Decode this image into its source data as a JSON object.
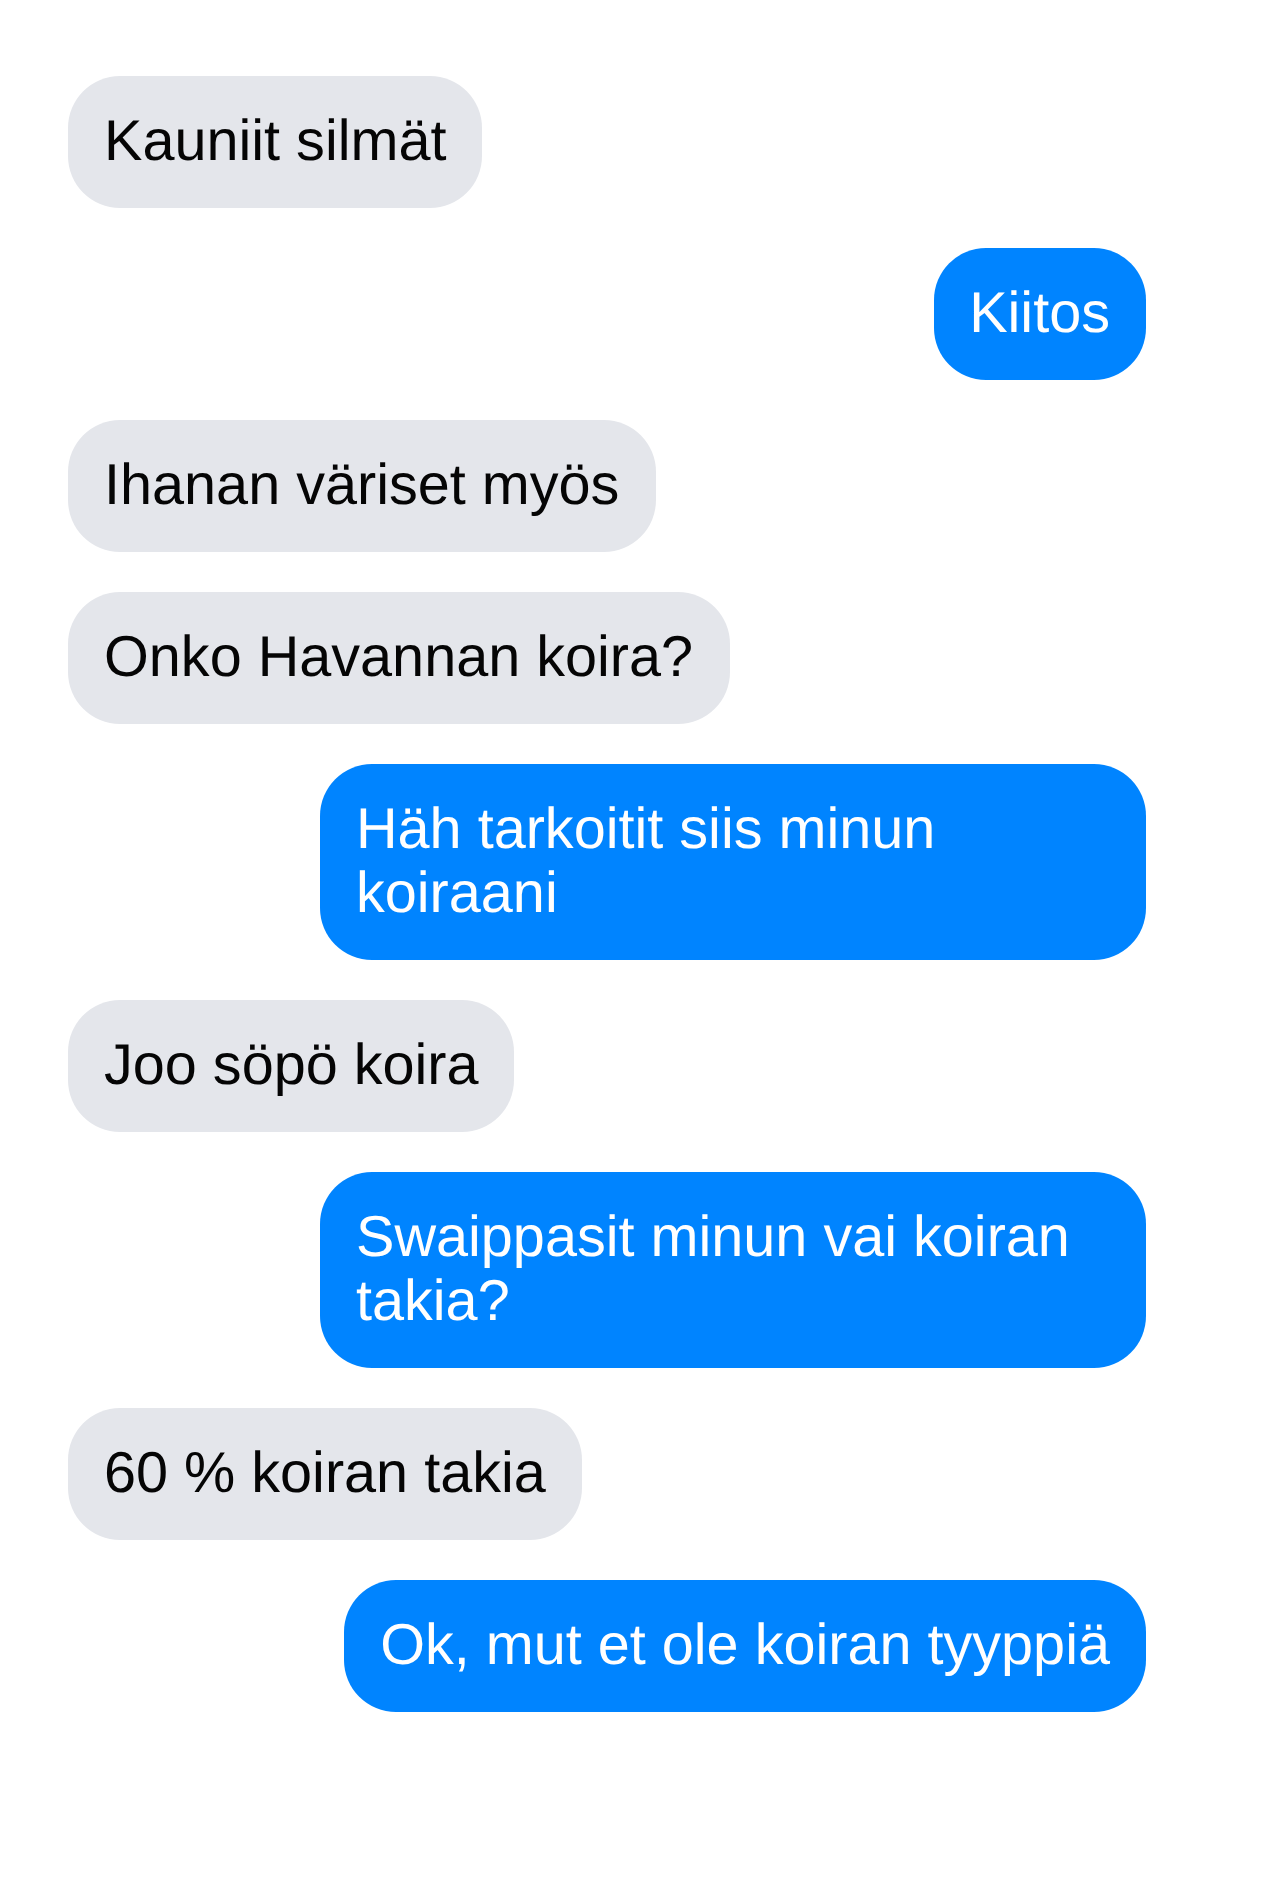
{
  "messages": [
    {
      "kind": "received",
      "text": "Kauniit silmät"
    },
    {
      "kind": "sent",
      "text": "Kiitos"
    },
    {
      "kind": "received",
      "text": "Ihanan väriset myös"
    },
    {
      "kind": "received",
      "text": "Onko Havannan koira?"
    },
    {
      "kind": "sent",
      "text": "Häh tarkoitit siis minun koiraani"
    },
    {
      "kind": "received",
      "text": "Joo söpö koira"
    },
    {
      "kind": "sent",
      "text": "Swaippasit minun vai koiran takia?"
    },
    {
      "kind": "received",
      "text": "60 % koiran takia"
    },
    {
      "kind": "sent",
      "text": "Ok, mut et ole koiran tyyppiä"
    }
  ]
}
